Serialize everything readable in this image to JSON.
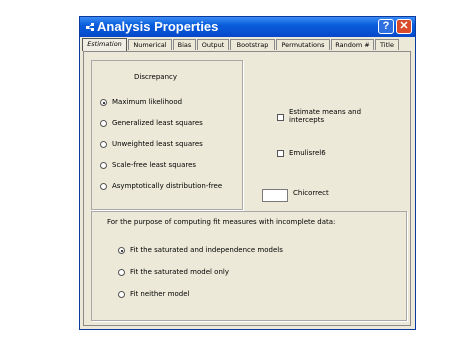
{
  "window": {
    "title": "Analysis Properties",
    "help_glyph": "?",
    "close_glyph": "✕"
  },
  "tabs": [
    "Estimation",
    "Numerical",
    "Bias",
    "Output",
    "Bootstrap",
    "Permutations",
    "Random #",
    "Title"
  ],
  "discrepancy": {
    "heading": "Discrepancy",
    "options": [
      "Maximum likelihood",
      "Generalized least squares",
      "Unweighted least squares",
      "Scale-free least squares",
      "Asymptotically distribution-free"
    ],
    "selected": "Maximum likelihood"
  },
  "checkboxes": {
    "estimate_line1": "Estimate means and",
    "estimate_line2": "intercepts",
    "emulisrel": "Emulisrel6"
  },
  "chicorrect": {
    "label": "Chicorrect",
    "value": ""
  },
  "incomplete": {
    "heading": "For the purpose of computing fit measures with incomplete data:",
    "options": [
      "Fit the saturated and independence models",
      "Fit the saturated model only",
      "Fit neither model"
    ],
    "selected": "Fit the saturated and independence models"
  }
}
